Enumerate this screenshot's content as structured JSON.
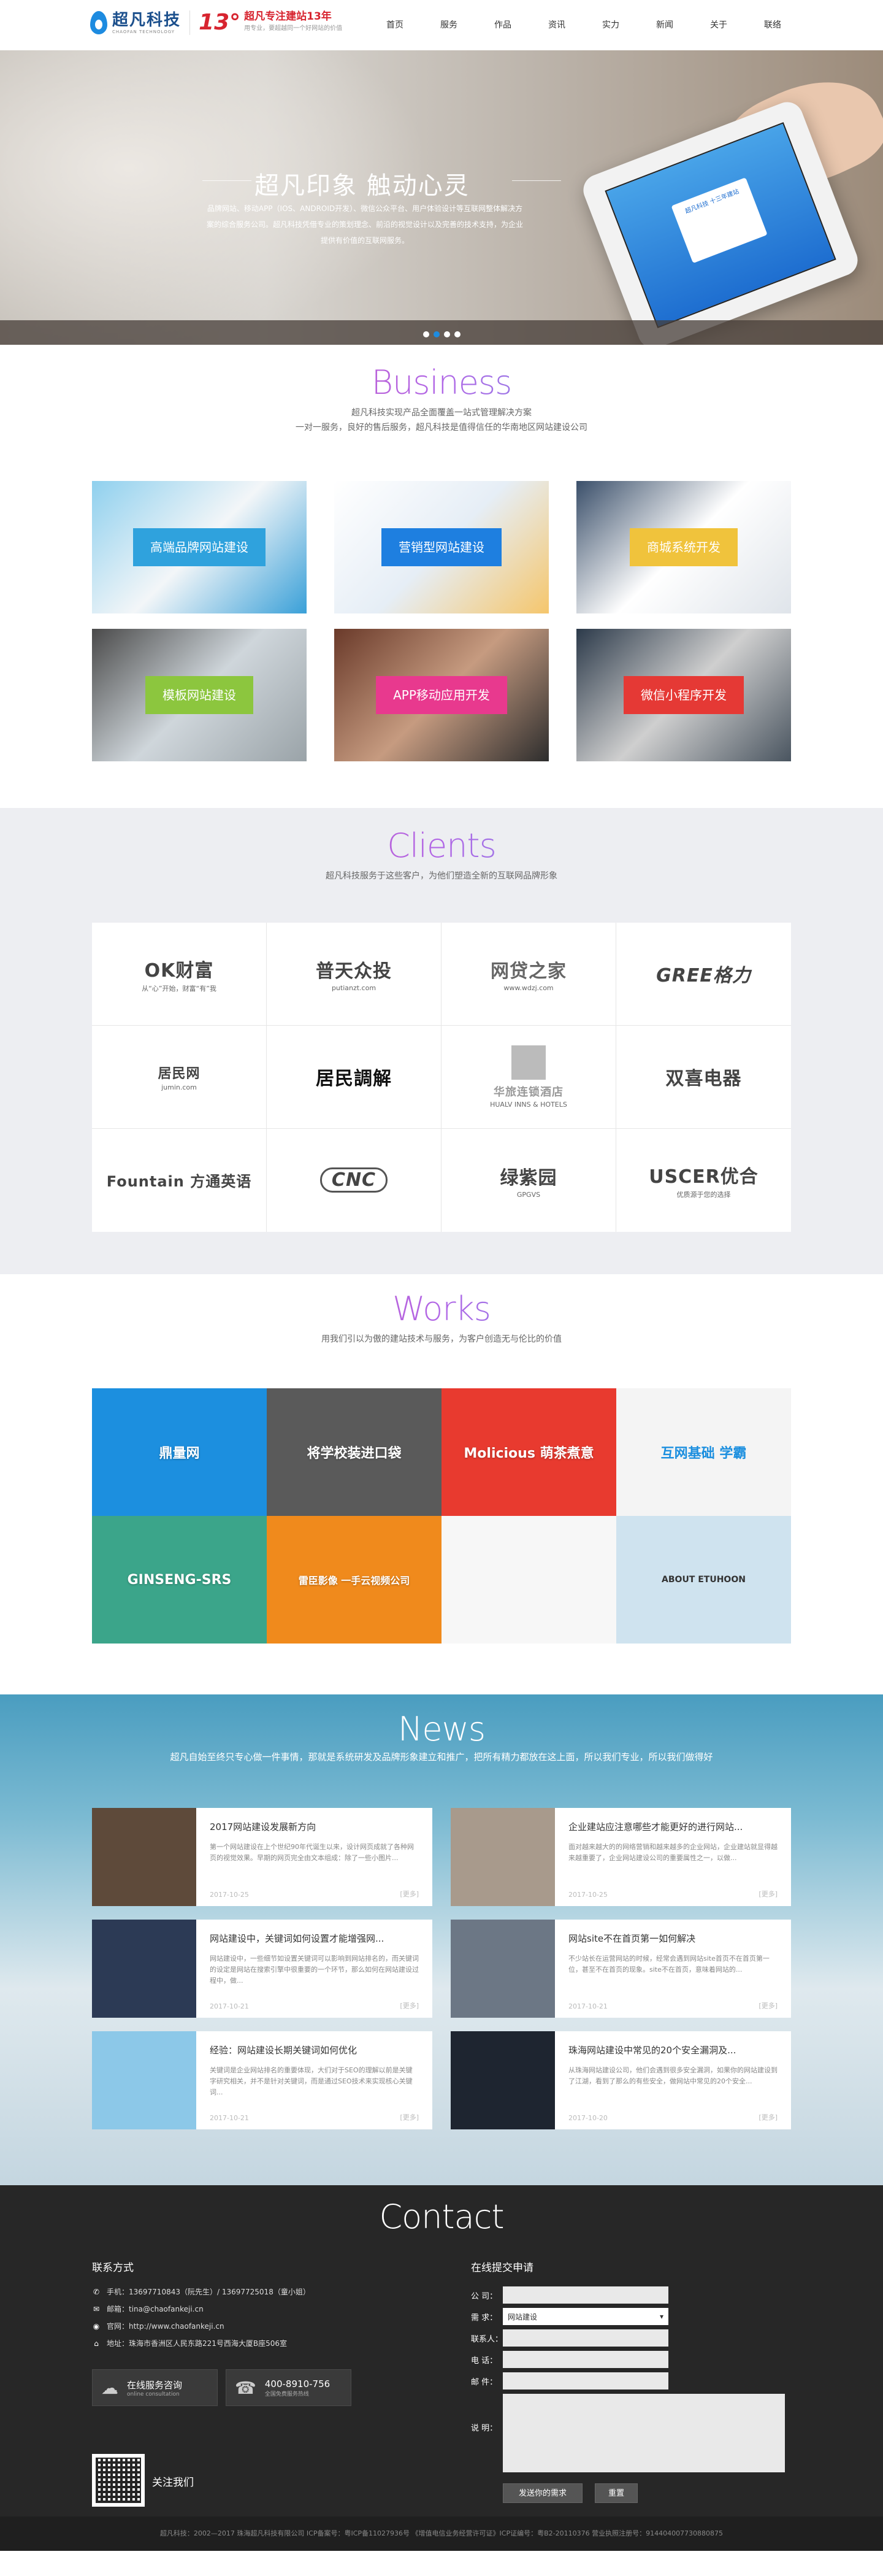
{
  "header": {
    "logo_cn": "超凡科技",
    "logo_en": "CHAOFAN TECHNOLOGY",
    "logo_years": "13°",
    "logo_slogan": "超凡专注建站13年",
    "logo_slogan2": "用专业，要超越同一个好网站的价值",
    "nav": [
      "首页",
      "服务",
      "作品",
      "资讯",
      "实力",
      "新闻",
      "关于",
      "联络"
    ]
  },
  "banner": {
    "title": "超凡印象 触动心灵",
    "desc": "品牌网站、移动APP（IOS、ANDROID开发）、微信公众平台、用户体验设计等互联网整体解决方案的综合服务公司。超凡科技凭借专业的策划理念、前沿的视觉设计以及完善的技术支持，为企业提供有价值的互联网服务。",
    "tablet_title": "超凡科技 十三年建站"
  },
  "business": {
    "title": "Business",
    "desc1": "超凡科技实现产品全面覆盖一站式管理解决方案",
    "desc2": "一对一服务，良好的售后服务，超凡科技是值得信任的华南地区网站建设公司",
    "items": [
      {
        "label": "高端品牌网站建设",
        "color": "#2fa2dd"
      },
      {
        "label": "营销型网站建设",
        "color": "#1e7fe0"
      },
      {
        "label": "商城系统开发",
        "color": "#f0c33c"
      },
      {
        "label": "模板网站建设",
        "color": "#8cc63e"
      },
      {
        "label": "APP移动应用开发",
        "color": "#e8398e"
      },
      {
        "label": "微信小程序开发",
        "color": "#e53935"
      }
    ]
  },
  "clients": {
    "title": "Clients",
    "desc": "超凡科技服务于这些客户，为他们塑造全新的互联网品牌形象",
    "logos": [
      {
        "main": "OK财富",
        "sub": "从“心”开始，财富“有”我"
      },
      {
        "main": "普天众投",
        "sub": "putianzt.com"
      },
      {
        "main": "网贷之家",
        "sub": "www.wdzj.com"
      },
      {
        "main": "GREE格力",
        "sub": ""
      },
      {
        "main": "居民网",
        "sub": "jumin.com"
      },
      {
        "main": "居民調解",
        "sub": ""
      },
      {
        "main": "华旅连锁酒店",
        "sub": "HUALV INNS & HOTELS"
      },
      {
        "main": "双喜电器",
        "sub": ""
      },
      {
        "main": "Fountain 方通英语",
        "sub": ""
      },
      {
        "main": "CNC",
        "sub": ""
      },
      {
        "main": "绿紫园",
        "sub": "GPGVS"
      },
      {
        "main": "USCER优合",
        "sub": "优质源于您的选择"
      }
    ]
  },
  "works": {
    "title": "Works",
    "desc": "用我们引以为傲的建站技术与服务，为客户创造无与伦比的价值",
    "items": [
      {
        "text": "鼎量网",
        "bg": "#1c8fdf"
      },
      {
        "text": "将学校装进口袋",
        "bg": "#5a5a5a"
      },
      {
        "text": "Molicious 萌茶煮意",
        "bg": "#e83a2f"
      },
      {
        "text": "互网基础 学霸",
        "bg": "#f4f4f4"
      },
      {
        "text": "GINSENG-SRS",
        "bg": "#3ba58a"
      },
      {
        "text": "雷臣影像 一手云视频公司",
        "bg": "#f08a1c"
      },
      {
        "text": "",
        "bg": "#f7f7f7"
      },
      {
        "text": "ABOUT ETUHOON",
        "bg": "#cfe3ef"
      }
    ]
  },
  "news": {
    "title": "News",
    "desc": "超凡自始至终只专心做一件事情，那就是系统研发及品牌形象建立和推广，把所有精力都放在这上面，所以我们专业，所以我们做得好",
    "more": "[更多]",
    "items": [
      {
        "title": "2017网站建设发展新方向",
        "text": "第一个网站建设在上个世纪90年代诞生以来，设计网页成就了各种网页的视觉效果。早期的网页完全由文本组成：除了一些小图片...",
        "date": "2017-10-25",
        "img": "#5e4a3a"
      },
      {
        "title": "企业建站应注意哪些才能更好的进行网站...",
        "text": "面对越来越大的的网络营销和越来越多的企业网站，企业建站就显得越来越重要了，企业网站建设公司的重要属性之一，以做...",
        "date": "2017-10-25",
        "img": "#a89a8c"
      },
      {
        "title": "网站建设中，关键词如何设置才能增强网...",
        "text": "网站建设中，一些细节如设置关键词可以影响到网站排名的，而关键词的设定是网站在搜索引擎中很重要的一个环节，那么如何在网站建设过程中，做...",
        "date": "2017-10-21",
        "img": "#2c3a55"
      },
      {
        "title": "网站site不在首页第一如何解决",
        "text": "不少站长在运营网站的时候，经常会遇到网站site首页不在首页第一位，甚至不在首页的现象。site不在首页，意味着网站的...",
        "date": "2017-10-21",
        "img": "#6c7785"
      },
      {
        "title": "经验：网站建设长期关键词如何优化",
        "text": "关键词是企业网站排名的重要体现，大们对于SEO的理解以前是关键字研究相关，并不是针对关键词，而是通过SEO技术来实现核心关键词...",
        "date": "2017-10-21",
        "img": "#8cc8e8"
      },
      {
        "title": "珠海网站建设中常见的20个安全漏洞及...",
        "text": "从珠海网站建设公司，他们会遇到很多安全漏洞，如果你的网站建设到了江湖，看到了那么的有些安全，做网站中常见的20个安全...",
        "date": "2017-10-20",
        "img": "#1e2530"
      }
    ]
  },
  "contact": {
    "title": "Contact",
    "left_title": "联系方式",
    "phone": "手机：13697710843（阮先生）/ 13697725018（童小姐）",
    "email": "邮箱：tina@chaofankeji.cn",
    "website": "官网：http://www.chaofankeji.cn",
    "address": "地址：珠海市香洲区人民东路221号西海大厦B座506室",
    "online_label": "在线服务咨询",
    "online_sub": "online consultation",
    "phone_big": "400-8910-756",
    "phone_sub": "全国免费服务热线",
    "follow": "关注我们",
    "right_title": "在线提交申请",
    "form": {
      "company_label": "公 司：",
      "need_label": "需 求：",
      "need_value": "网站建设",
      "contact_label": "联系人：",
      "tel_label": "电 话：",
      "mail_label": "邮 件：",
      "desc_label": "说 明：",
      "submit": "发送你的需求",
      "reset": "重置"
    }
  },
  "footer": {
    "text": "超凡科技：2002—2017 珠海超凡科技有限公司    ICP备案号：粤ICP备11027936号    《增值电信业务经营许可证》ICP证编号：粤B2-20110376    营业执照注册号：914404007730880875"
  }
}
